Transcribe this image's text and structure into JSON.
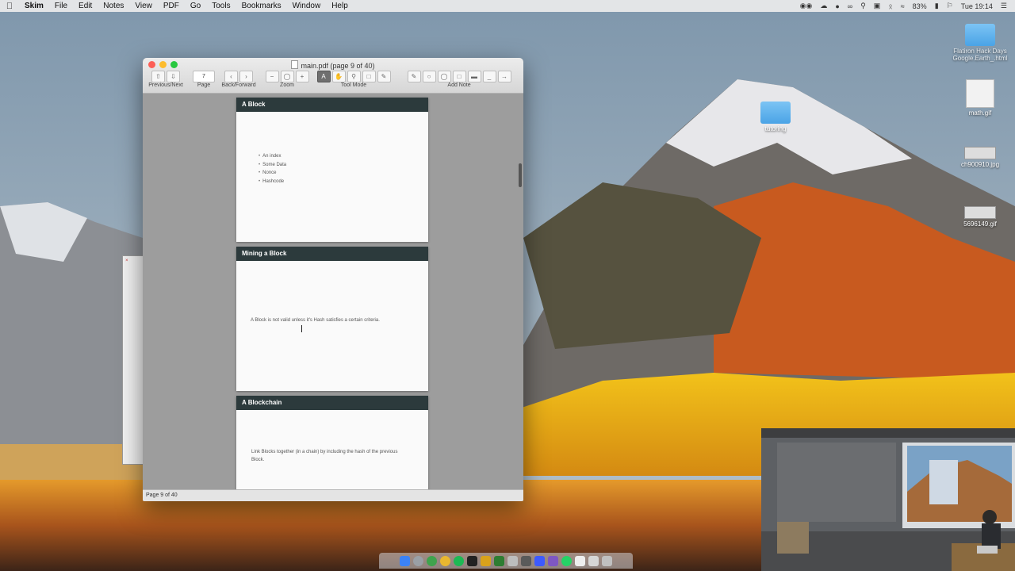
{
  "menubar": {
    "app_name": "Skim",
    "items": [
      "File",
      "Edit",
      "Notes",
      "View",
      "PDF",
      "Go",
      "Tools",
      "Bookmarks",
      "Window",
      "Help"
    ],
    "battery": "83%",
    "clock": "Tue 19:14"
  },
  "desktop": {
    "icons": [
      {
        "label": "Flatiron Hack Days\nGoogle.Earth_.html"
      },
      {
        "label": "math.gif"
      },
      {
        "label": "tutoring"
      },
      {
        "label": "ch900910.jpg"
      },
      {
        "label": "5696149.gif"
      }
    ]
  },
  "window": {
    "title": "main.pdf (page 9 of 40)",
    "toolbar": {
      "page_value": "7",
      "labels": {
        "previous_next": "Previous/Next",
        "page": "Page",
        "back_forward": "Back/Forward",
        "zoom": "Zoom",
        "tool_mode": "Tool Mode",
        "add_note": "Add Note"
      }
    },
    "slides": [
      {
        "title": "A Block",
        "bullets": [
          "An index",
          "Some Data",
          "Nonce",
          "Hashcode"
        ]
      },
      {
        "title": "Mining a Block",
        "text": "A Block is not valid unless it's Hash satisfies a certain criteria."
      },
      {
        "title": "A Blockchain",
        "text": "Link Blocks together (in a chain) by including the hash of the previous Block."
      }
    ],
    "status": "Page 9 of 40"
  },
  "colors": {
    "slide_header": "#2c3a3c",
    "content_background": "#9d9d9d",
    "close": "#fc5f57",
    "minimize": "#fdbc2e",
    "maximize": "#28c840"
  }
}
